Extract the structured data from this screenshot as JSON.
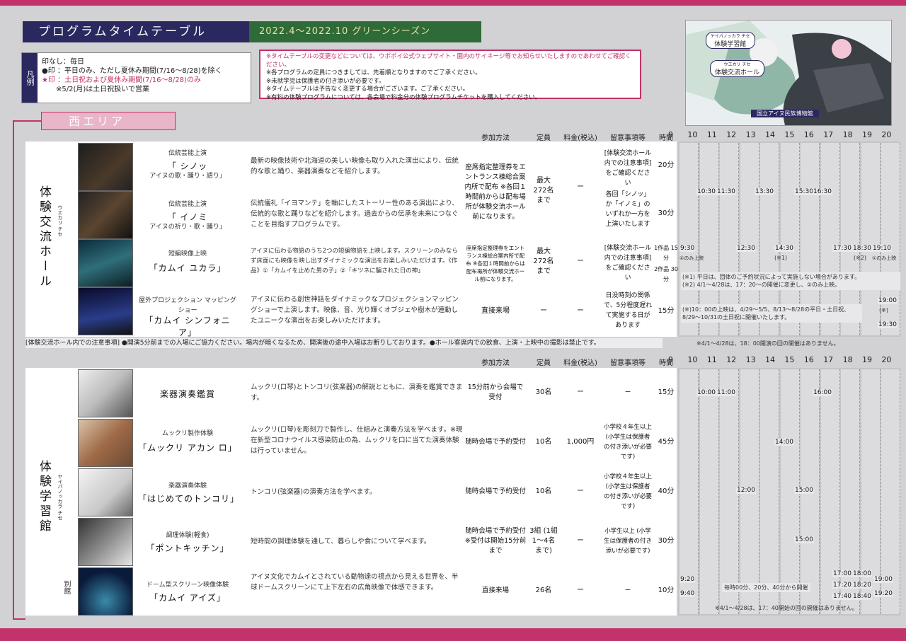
{
  "header": {
    "title": "プログラムタイムテーブル",
    "season": "2022.4〜2022.10 グリーンシーズン"
  },
  "legend": {
    "tag": "凡例",
    "line1": "印なし：毎日",
    "line2": "●印 ：平日のみ、ただし夏休み期間(7/16〜8/28)を除く",
    "line3": "★印 ：土日祝および夏休み期間(7/16〜8/28)のみ",
    "line4": "※5/2(月)は土日祝扱いで営業"
  },
  "notes": [
    "※タイムテーブルの変更などについては、ウポポイ公式ウェブサイト・園内のサイネージ等でお知らせいたしますのであわせてご確認ください。",
    "※各プログラムの定員につきましては、先着順となりますのでご了承ください。",
    "※未就学児は保護者の付き添いが必要です。",
    "※タイムテーブルは予告なく変更する場合がございます。ご了承ください。",
    "※有料の体験プログラムについては、各会場で料金分の体験プログラムチケットを購入してください。"
  ],
  "map": {
    "label1": "体験学習館",
    "label1_ruby": "ヤイパノッカラ チセ",
    "label2": "体験交流ホール",
    "label2_ruby": "ウエカリ チセ",
    "label3": "国立アイヌ民族博物館"
  },
  "area": {
    "west": "西エリア"
  },
  "columns": {
    "method": "参加方法",
    "capacity": "定員",
    "fee": "料金(税込)",
    "notes": "留意事項等",
    "time": "時間",
    "hours": [
      "9",
      "10",
      "11",
      "12",
      "13",
      "14",
      "15",
      "16",
      "17",
      "18",
      "19",
      "20"
    ]
  },
  "hall": {
    "name": "体験交流ホール",
    "ruby": "ウエカリ チセ",
    "rows": [
      {
        "category": "伝統芸能上演",
        "title": "「 シノッ",
        "subtitle": "アイヌの歌・踊り・語り」",
        "desc": "最新の映像技術や北海道の美しい映像も取り入れた演出により、伝統的な歌と踊り、楽器演奏などを紹介します。",
        "duration": "20分"
      },
      {
        "category": "伝統芸能上演",
        "title": "「 イノミ",
        "subtitle": "アイヌの祈り・歌・踊り」",
        "desc": "伝統儀礼「イヨマンテ」を軸にしたストーリー性のある演出により、伝統的な歌と踊りなどを紹介します。過去からの伝承を未来につなぐことを目指すプログラムです。",
        "duration": "30分"
      },
      {
        "category": "短編映像上映",
        "title": "「カムイ ユカラ」",
        "desc": "アイヌに伝わる物語のうち2つの短編物語を上映します。スクリーンのみならず床面にも映像を映し出すダイナミックな演出をお楽しみいただけます。《作品》①「カムイを止めた男の子」②「キツネに騙された日の神」",
        "duration1": "1作品 15分",
        "duration2": "2作品 30分"
      },
      {
        "category": "屋外プロジェクション マッピングショー",
        "title": "「カムイ シンフォニア」",
        "desc": "アイヌに伝わる創世神話をダイナミックなプロジェクションマッピングショーで上演します。映像、音、光り輝くオブジェや樹木が連動したユニークな演出をお楽しみいただけます。",
        "method": "直接来場",
        "capacity": "ー",
        "fee": "ー",
        "notes": "日没時刻の関係で、5分程度遅れて実施する日があります",
        "duration": "15分"
      }
    ],
    "method_a": "座席指定整理券をエントランス棟総合案内所で配布 ※各回１時間前からは配布場所が体験交流ホール前になります。",
    "method_b": "座席指定整理券をエントランス棟総合案内所で配布 ※各回１時間前からは配布場所が体験交流ホール前になります。",
    "capacity_a": "最大 272名 まで",
    "capacity_b": "最大 272名 まで",
    "fee_a": "ー",
    "fee_b": "ー",
    "notes_a": "[体験交流ホール内での注意事項]をご確認ください",
    "notes_ab": "各回「シノッ」か「イノミ」のいずれか一方を上演いたします",
    "notes_b": "[体験交流ホール内での注意事項]をご確認ください",
    "times": {
      "r12": [
        "10:30",
        "11:30",
        "13:30",
        "15:30",
        "16:30"
      ],
      "r3": [
        "9:30",
        "12:30",
        "14:30",
        "17:30",
        "18:30",
        "19:10"
      ],
      "r3_notes": [
        "(※1)",
        "(※2)",
        "④のみ上映",
        "①のみ上映"
      ],
      "r3_footnote1": "(※1) 平日は、団体のご予約状況によって実施しない場合があります。",
      "r3_footnote2": "(※2) 4/1〜4/28は、17：20〜の開催に変更し、②のみ上映。",
      "r4_note": "(※)10：00の上映は、4/29〜5/5、8/13〜8/28の平日・土日祝、8/29〜10/31の土日祝に開催いたします。",
      "r4_times": [
        "19:00",
        "(※)",
        "19:30"
      ],
      "r4_footnote": "※4/1〜4/28は、18：00開演の回の開催はありません。"
    }
  },
  "hall_notice": "[体験交流ホール内での注意事項] ●開演5分前までの入場にご協力ください。場内が暗くなるため、開演後の途中入場はお断りしております。●ホール客席内での飲食、上演・上映中の撮影は禁止です。",
  "learning": {
    "name": "体験学習館",
    "ruby": "ヤイパノッカラ チセ",
    "annex": "別館",
    "rows": [
      {
        "category": "楽器演奏鑑賞",
        "title": "",
        "desc": "ムックリ(口琴)とトンコリ(弦楽器)の解説とともに、演奏を鑑賞できます。",
        "method": "15分前から会場で受付",
        "capacity": "30名",
        "fee": "ー",
        "notes": "ー",
        "duration": "15分",
        "times": [
          "10:00",
          "11:00",
          "16:00"
        ]
      },
      {
        "category": "ムックリ製作体験",
        "title": "「ムックリ アカン ロ」",
        "desc": "ムックリ(口琴)を彫刻刀で製作し、仕組みと演奏方法を学べます。※現在新型コロナウイルス感染防止の為、ムックリを口に当てた演奏体験は行っていません。",
        "method": "随時会場で予約受付",
        "capacity": "10名",
        "fee": "1,000円",
        "notes": "小学校４年生以上 (小学生は保護者の付き添いが必要です)",
        "duration": "45分",
        "times": [
          "14:00"
        ]
      },
      {
        "category": "楽器演奏体験",
        "title": "「はじめてのトンコリ」",
        "desc": "トンコリ(弦楽器)の演奏方法を学べます。",
        "method": "随時会場で予約受付",
        "capacity": "10名",
        "fee": "ー",
        "notes": "小学校４年生以上 (小学生は保護者の付き添いが必要です)",
        "duration": "40分",
        "times": [
          "12:00",
          "15:00"
        ]
      },
      {
        "category": "調理体験(軽食)",
        "title": "「ポントキッチン」",
        "desc": "短時間の調理体験を通して、暮らしや食について学べます。",
        "method": "随時会場で予約受付 ※受付は開始15分前まで",
        "capacity": "3組 (1組1〜4名まで)",
        "fee": "ー",
        "notes": "小学生以上 (小学生は保護者の付き添いが必要です)",
        "duration": "30分",
        "times": [
          "15:00"
        ]
      },
      {
        "category": "ドーム型スクリーン映像体験",
        "title": "「カムイ アイズ」",
        "desc": "アイヌ文化でカムイとされている動物達の視点から見える世界を、半球ドームスクリーンにて上下左右の広角映像で体感できます。",
        "method": "直接来場",
        "capacity": "26名",
        "fee": "ー",
        "notes": "ー",
        "duration": "10分",
        "times_left": [
          "9:20",
          "9:40"
        ],
        "band": "毎時00分、20分、40分から開催",
        "times_right": [
          "17:00",
          "18:00",
          "17:20",
          "18:20",
          "17:40",
          "18:40",
          "19:00",
          "19:20"
        ],
        "footnote": "※4/1〜4/28は、17：40開始の回の開催はありません。"
      }
    ]
  },
  "colors": {
    "accent": "#c2326b",
    "navy": "#2b2860",
    "green": "#2f6a39"
  }
}
